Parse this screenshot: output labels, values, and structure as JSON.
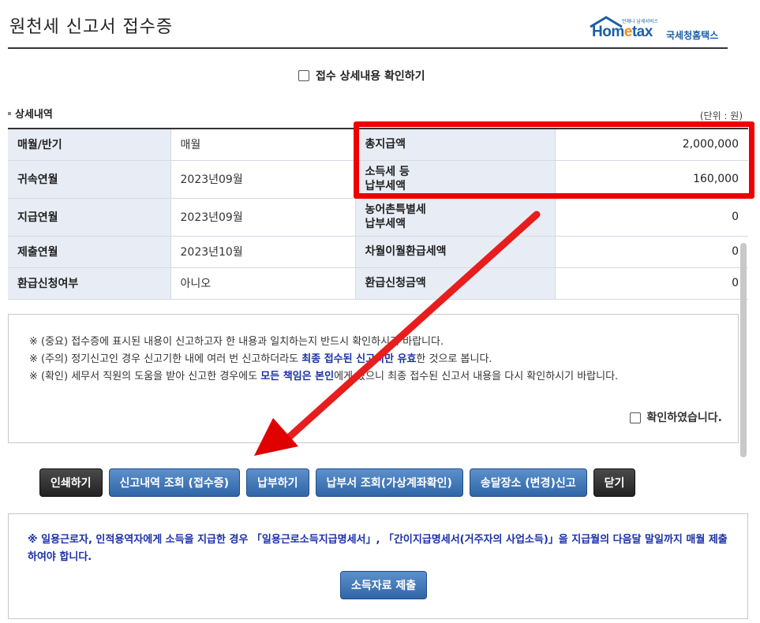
{
  "header": {
    "title": "원천세 신고서 접수증",
    "logo_text": "Hometax",
    "logo_tagline": "언제나 납세서비스",
    "logo_korean": "국세청홈택스"
  },
  "confirm_detail_label": "접수 상세내용 확인하기",
  "section": {
    "title": "상세내역",
    "unit": "(단위 : 원)"
  },
  "rows": [
    {
      "label": "매월/반기",
      "value": "매월",
      "label2": "총지급액",
      "amount": "2,000,000"
    },
    {
      "label": "귀속연월",
      "value": "2023년09월",
      "label2a": "소득세 등",
      "label2b": "납부세액",
      "amount": "160,000"
    },
    {
      "label": "지급연월",
      "value": "2023년09월",
      "label2a": "농어촌특별세",
      "label2b": "납부세액",
      "amount": "0"
    },
    {
      "label": "제출연월",
      "value": "2023년10월",
      "label2": "차월이월환급세액",
      "amount": "0"
    },
    {
      "label": "환급신청여부",
      "value": "아니오",
      "label2": "환급신청금액",
      "amount": "0"
    }
  ],
  "notice": {
    "line1": "※ (중요) 접수증에 표시된 내용이 신고하고자 한 내용과 일치하는지 반드시 확인하시기 바랍니다.",
    "line2_pre": "※ (주의) 정기신고인 경우 신고기한 내에 여러 번 신고하더라도 ",
    "line2_hl1": "최종 접수된 신고서만 유효",
    "line2_post": "한 것으로 봅니다.",
    "line3_pre": "※ (확인) 세무서 직원의 도움을 받아 신고한 경우에도 ",
    "line3_hl": "모든 책임은 본인",
    "line3_post": "에게 있으니 최종 접수된 신고서 내용을 다시 확인하시기 바랍니다.",
    "agree_label": "확인하였습니다."
  },
  "buttons": {
    "print": "인쇄하기",
    "history": "신고내역 조회 (접수증)",
    "pay": "납부하기",
    "payment_slip": "납부서 조회(가상계좌확인)",
    "delivery": "송달장소 (변경)신고",
    "close": "닫기"
  },
  "bottom": {
    "text": "※ 일용근로자, 인적용역자에게 소득을 지급한 경우 「일용근로소득지급명세서」, 「간이지급명세서(거주자의 사업소득)」을 지급월의 다음달 말일까지 매월 제출하여야 합니다.",
    "submit": "소득자료 제출"
  },
  "colors": {
    "highlight": "#e00000",
    "button_blue": "#2f66a6",
    "button_dark": "#222222",
    "notice_blue": "#1a2fa8"
  }
}
